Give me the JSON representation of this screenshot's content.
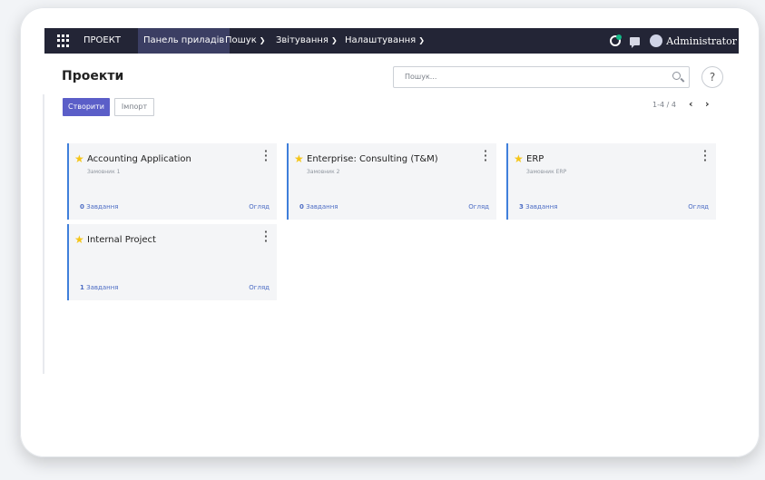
{
  "navbar": {
    "brand": "ПРОЕКТ",
    "active_item": "Панель приладів",
    "menus": [
      {
        "label": "Пошук"
      },
      {
        "label": "Звітування"
      },
      {
        "label": "Налаштування"
      }
    ],
    "user": "Administrator"
  },
  "control_panel": {
    "title": "Проекти",
    "search_placeholder": "Пошук...",
    "help_label": "?",
    "create_button": "Створити",
    "import_button": "Імпорт",
    "pager_value": "1-4 / 4",
    "pager_prev": "‹",
    "pager_next": "›"
  },
  "projects": [
    {
      "name": "Accounting Application",
      "customer": "Замовник 1",
      "task_count": "0",
      "task_label": "Завдання",
      "overview": "Огляд"
    },
    {
      "name": "Enterprise: Consulting (T&M)",
      "customer": "Замовник 2",
      "task_count": "0",
      "task_label": "Завдання",
      "overview": "Огляд"
    },
    {
      "name": "ERP",
      "customer": "Замовник ERP",
      "task_count": "3",
      "task_label": "Завдання",
      "overview": "Огляд"
    },
    {
      "name": "Internal Project",
      "customer": "",
      "task_count": "1",
      "task_label": "Завдання",
      "overview": "Огляд"
    }
  ],
  "colors": {
    "navbar_bg": "#232536",
    "primary": "#5b5ec8",
    "card_accent": "#3f7fdb",
    "star": "#f5c518"
  }
}
